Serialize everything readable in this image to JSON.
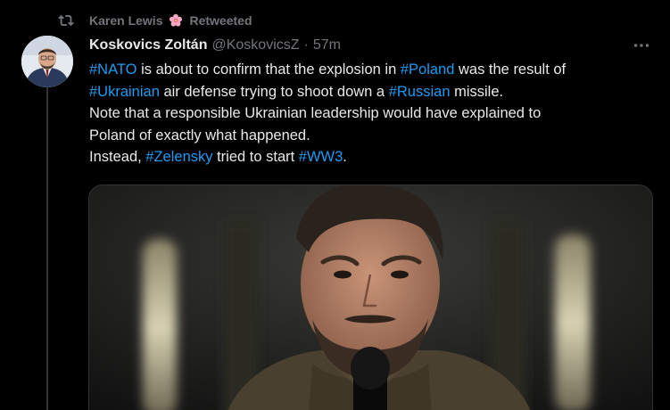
{
  "retweet": {
    "user": "Karen Lewis",
    "emoji": "🌸",
    "label": "Retweeted"
  },
  "author": {
    "name": "Koskovics Zoltán",
    "handle": "@KoskovicsZ",
    "separator": "·",
    "time": "57m"
  },
  "tweet": {
    "l1_tag1": "#NATO",
    "l1_t1": " is about to confirm that the explosion in ",
    "l1_tag2": "#Poland",
    "l1_t2": " was the result of",
    "l2_tag1": "#Ukrainian",
    "l2_t1": " air defense trying to shoot down a ",
    "l2_tag2": "#Russian",
    "l2_t2": " missile.",
    "l3": "Note that a responsible Ukrainian leadership would have explained to",
    "l4": "Poland of exactly what happened.",
    "l5_t1": "Instead, ",
    "l5_tag1": "#Zelensky",
    "l5_t2": " tried to start ",
    "l5_tag2": "#WW3",
    "l5_t3": "."
  },
  "colors": {
    "background": "#000000",
    "text": "#e7e9ea",
    "muted": "#71767b",
    "hashtag": "#1d9bf0",
    "border": "#2f3336"
  },
  "icons": {
    "retweet": "retweet-icon",
    "more": "more-horizontal-icon",
    "flower": "cherry-blossom-icon"
  }
}
